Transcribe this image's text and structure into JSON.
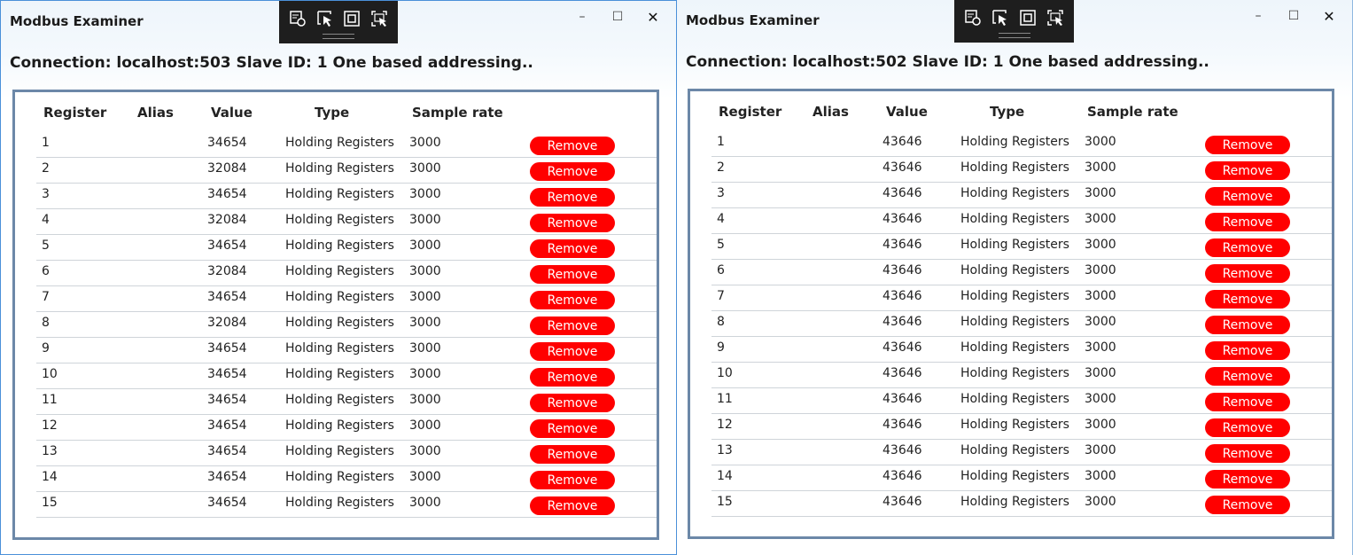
{
  "app_title": "Modbus Examiner",
  "caption": {
    "minimize": "–",
    "maximize": "☐",
    "close": "✕"
  },
  "headers": {
    "register": "Register",
    "alias": "Alias",
    "value": "Value",
    "type": "Type",
    "sample_rate": "Sample rate"
  },
  "remove_label": "Remove",
  "windows": [
    {
      "connection": "Connection: localhost:503 Slave ID: 1 One based addressing..",
      "rows": [
        {
          "register": "1",
          "alias": "",
          "value": "34654",
          "type": "Holding Registers",
          "rate": "3000"
        },
        {
          "register": "2",
          "alias": "",
          "value": "32084",
          "type": "Holding Registers",
          "rate": "3000"
        },
        {
          "register": "3",
          "alias": "",
          "value": "34654",
          "type": "Holding Registers",
          "rate": "3000"
        },
        {
          "register": "4",
          "alias": "",
          "value": "32084",
          "type": "Holding Registers",
          "rate": "3000"
        },
        {
          "register": "5",
          "alias": "",
          "value": "34654",
          "type": "Holding Registers",
          "rate": "3000"
        },
        {
          "register": "6",
          "alias": "",
          "value": "32084",
          "type": "Holding Registers",
          "rate": "3000"
        },
        {
          "register": "7",
          "alias": "",
          "value": "34654",
          "type": "Holding Registers",
          "rate": "3000"
        },
        {
          "register": "8",
          "alias": "",
          "value": "32084",
          "type": "Holding Registers",
          "rate": "3000"
        },
        {
          "register": "9",
          "alias": "",
          "value": "34654",
          "type": "Holding Registers",
          "rate": "3000"
        },
        {
          "register": "10",
          "alias": "",
          "value": "34654",
          "type": "Holding Registers",
          "rate": "3000"
        },
        {
          "register": "11",
          "alias": "",
          "value": "34654",
          "type": "Holding Registers",
          "rate": "3000"
        },
        {
          "register": "12",
          "alias": "",
          "value": "34654",
          "type": "Holding Registers",
          "rate": "3000"
        },
        {
          "register": "13",
          "alias": "",
          "value": "34654",
          "type": "Holding Registers",
          "rate": "3000"
        },
        {
          "register": "14",
          "alias": "",
          "value": "34654",
          "type": "Holding Registers",
          "rate": "3000"
        },
        {
          "register": "15",
          "alias": "",
          "value": "34654",
          "type": "Holding Registers",
          "rate": "3000"
        }
      ]
    },
    {
      "connection": "Connection: localhost:502 Slave ID: 1 One based addressing..",
      "rows": [
        {
          "register": "1",
          "alias": "",
          "value": "43646",
          "type": "Holding Registers",
          "rate": "3000"
        },
        {
          "register": "2",
          "alias": "",
          "value": "43646",
          "type": "Holding Registers",
          "rate": "3000"
        },
        {
          "register": "3",
          "alias": "",
          "value": "43646",
          "type": "Holding Registers",
          "rate": "3000"
        },
        {
          "register": "4",
          "alias": "",
          "value": "43646",
          "type": "Holding Registers",
          "rate": "3000"
        },
        {
          "register": "5",
          "alias": "",
          "value": "43646",
          "type": "Holding Registers",
          "rate": "3000"
        },
        {
          "register": "6",
          "alias": "",
          "value": "43646",
          "type": "Holding Registers",
          "rate": "3000"
        },
        {
          "register": "7",
          "alias": "",
          "value": "43646",
          "type": "Holding Registers",
          "rate": "3000"
        },
        {
          "register": "8",
          "alias": "",
          "value": "43646",
          "type": "Holding Registers",
          "rate": "3000"
        },
        {
          "register": "9",
          "alias": "",
          "value": "43646",
          "type": "Holding Registers",
          "rate": "3000"
        },
        {
          "register": "10",
          "alias": "",
          "value": "43646",
          "type": "Holding Registers",
          "rate": "3000"
        },
        {
          "register": "11",
          "alias": "",
          "value": "43646",
          "type": "Holding Registers",
          "rate": "3000"
        },
        {
          "register": "12",
          "alias": "",
          "value": "43646",
          "type": "Holding Registers",
          "rate": "3000"
        },
        {
          "register": "13",
          "alias": "",
          "value": "43646",
          "type": "Holding Registers",
          "rate": "3000"
        },
        {
          "register": "14",
          "alias": "",
          "value": "43646",
          "type": "Holding Registers",
          "rate": "3000"
        },
        {
          "register": "15",
          "alias": "",
          "value": "43646",
          "type": "Holding Registers",
          "rate": "3000"
        }
      ]
    }
  ],
  "colors": {
    "remove_button": "#ff0000",
    "grid_border": "#6c88a8",
    "window_border": "#4a90d9",
    "devbar": "#1e1e1e"
  },
  "devbar_icons": [
    "select-element-icon",
    "pointer-icon",
    "layout-adorner-icon",
    "track-focus-icon"
  ]
}
